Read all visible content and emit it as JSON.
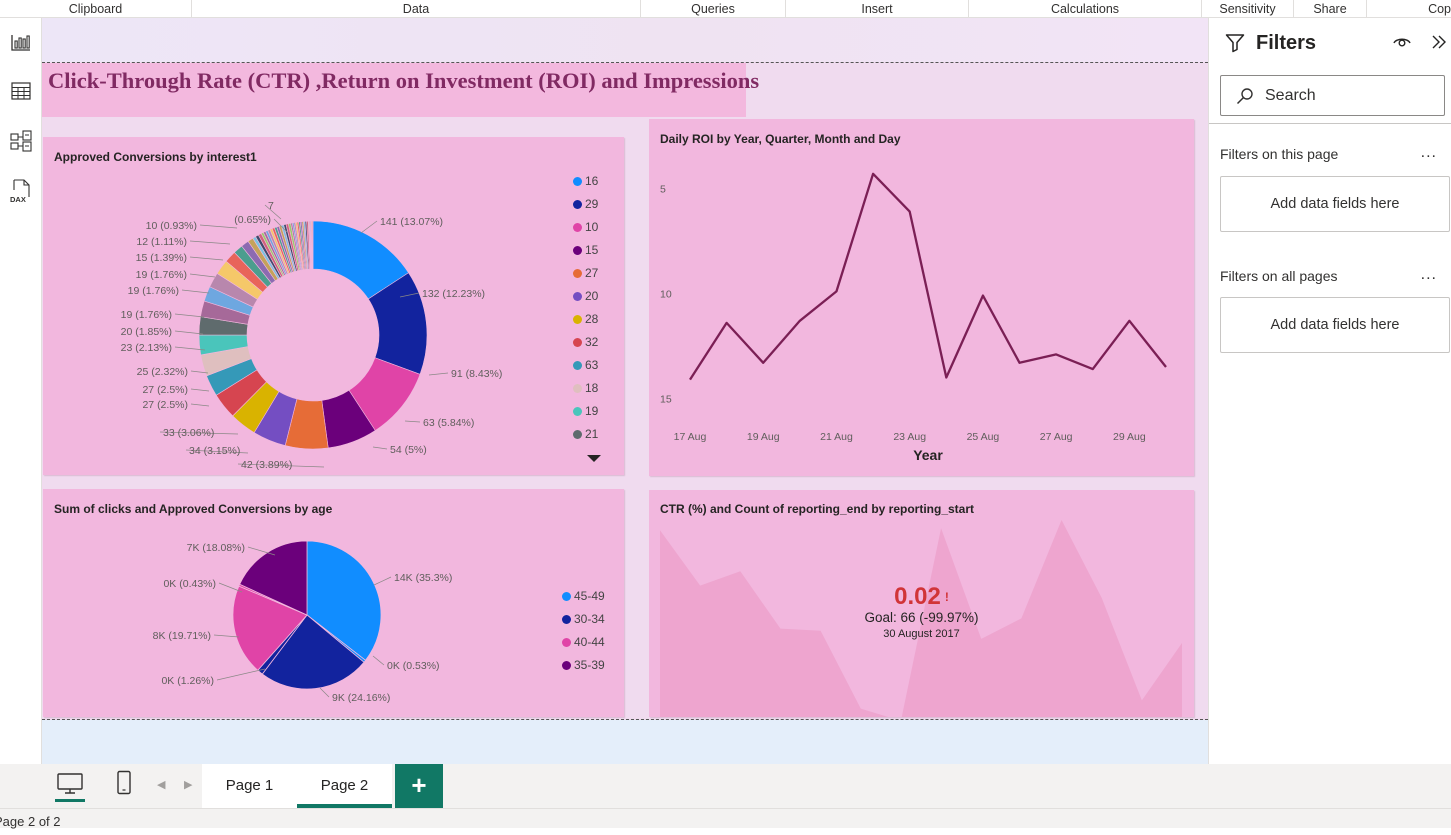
{
  "ribbon": {
    "groups": [
      "Clipboard",
      "Data",
      "Queries",
      "Insert",
      "Calculations",
      "Sensitivity",
      "Share",
      "Cop"
    ]
  },
  "left_nav": {
    "icons": [
      "report-view-icon",
      "table-view-icon",
      "model-view-icon",
      "dax-query-view-icon"
    ],
    "dax_label": "DAX"
  },
  "report": {
    "title": "Click-Through Rate (CTR) ,Return on Investment (ROI) and Impressions",
    "colors": {
      "title": "#812a63",
      "visual_bg": "#f2b7de",
      "line": "#7b1f55",
      "kpi": "#d13438"
    }
  },
  "donut": {
    "title": "Approved Conversions by interest1",
    "legend": [
      {
        "label": "16",
        "color": "#118dff"
      },
      {
        "label": "29",
        "color": "#12239e"
      },
      {
        "label": "10",
        "color": "#e044a7"
      },
      {
        "label": "15",
        "color": "#6b007b"
      },
      {
        "label": "27",
        "color": "#e66c37"
      },
      {
        "label": "20",
        "color": "#744ec2"
      },
      {
        "label": "28",
        "color": "#d9b300"
      },
      {
        "label": "32",
        "color": "#d64550"
      },
      {
        "label": "63",
        "color": "#3599b8"
      },
      {
        "label": "18",
        "color": "#dfbfbf"
      },
      {
        "label": "19",
        "color": "#4ac5bb"
      },
      {
        "label": "21",
        "color": "#5f6b6d"
      }
    ],
    "data_labels": [
      "141 (13.07%)",
      "132 (12.23%)",
      "91 (8.43%)",
      "63 (5.84%)",
      "54 (5%)",
      "42 (3.89%)",
      "34 (3.15%)",
      "33 (3.06%)",
      "27 (2.5%)",
      "27 (2.5%)",
      "25 (2.32%)",
      "23 (2.13%)",
      "20 (1.85%)",
      "19 (1.76%)",
      "19 (1.76%)",
      "19 (1.76%)",
      "15 (1.39%)",
      "12 (1.11%)",
      "10 (0.93%)",
      "7",
      "(0.65%)"
    ]
  },
  "pie": {
    "title": "Sum of clicks and Approved Conversions by age",
    "legend": [
      {
        "label": "45-49",
        "color": "#118dff"
      },
      {
        "label": "30-34",
        "color": "#12239e"
      },
      {
        "label": "40-44",
        "color": "#e044a7"
      },
      {
        "label": "35-39",
        "color": "#6b007b"
      }
    ],
    "data_labels": [
      "14K (35.3%)",
      "0K (0.53%)",
      "9K (24.16%)",
      "0K (1.26%)",
      "8K (19.71%)",
      "0K (0.43%)",
      "7K (18.08%)"
    ]
  },
  "line_visual": {
    "title": "Daily ROI by Year, Quarter, Month and Day",
    "xlabel": "Year",
    "y_ticks": [
      "15",
      "10",
      "5"
    ],
    "x_ticks": [
      "17 Aug",
      "19 Aug",
      "21 Aug",
      "23 Aug",
      "25 Aug",
      "27 Aug",
      "29 Aug"
    ]
  },
  "kpi_visual": {
    "title": "CTR (%) and Count of reporting_end by reporting_start",
    "value": "0.02",
    "indicator": "!",
    "goal": "Goal: 66 (-99.97%)",
    "date": "30 August 2017"
  },
  "filters_pane": {
    "title": "Filters",
    "search_placeholder": "Search",
    "section_page": "Filters on this page",
    "section_all": "Filters on all pages",
    "add_fields": "Add data fields here",
    "more": "..."
  },
  "page_tabs": {
    "tabs": [
      "Page 1",
      "Page 2"
    ],
    "active": "Page 2",
    "add_label": "+"
  },
  "status_bar": {
    "text": "Page 2 of 2"
  },
  "chart_data": [
    {
      "type": "pie",
      "title": "Approved Conversions by interest1",
      "categories": [
        "16",
        "29",
        "10",
        "15",
        "27",
        "20",
        "28",
        "32",
        "63",
        "18",
        "19",
        "21"
      ],
      "slice_values": [
        141,
        132,
        91,
        63,
        54,
        42,
        34,
        33,
        27,
        27,
        25,
        23,
        20,
        19,
        19,
        19,
        15,
        12,
        10,
        7,
        4,
        4,
        4,
        3,
        3,
        3,
        3,
        3,
        3,
        3,
        3,
        3,
        3,
        3,
        3,
        3,
        2,
        2,
        2,
        2,
        2,
        2,
        2,
        2,
        2,
        2,
        2,
        1,
        1,
        1,
        1,
        1,
        1
      ],
      "slice_labels": [
        "141 (13.07%)",
        "132 (12.23%)",
        "91 (8.43%)",
        "63 (5.84%)",
        "54 (5%)",
        "42 (3.89%)",
        "34 (3.15%)",
        "33 (3.06%)",
        "27 (2.5%)",
        "27 (2.5%)",
        "25 (2.32%)",
        "23 (2.13%)",
        "20 (1.85%)",
        "19 (1.76%)",
        "19 (1.76%)",
        "19 (1.76%)",
        "15 (1.39%)",
        "12 (1.11%)",
        "10 (0.93%)",
        "7 (0.65%)"
      ],
      "donut": true
    },
    {
      "type": "pie",
      "title": "Sum of clicks and Approved Conversions by age",
      "slices": [
        {
          "label": "14K (35.3%)",
          "value": 35.3,
          "color": "#118dff"
        },
        {
          "label": "0K (0.53%)",
          "value": 0.53,
          "color": "#118dff"
        },
        {
          "label": "9K (24.16%)",
          "value": 24.16,
          "color": "#12239e"
        },
        {
          "label": "0K (1.26%)",
          "value": 1.26,
          "color": "#12239e"
        },
        {
          "label": "8K (19.71%)",
          "value": 19.71,
          "color": "#e044a7"
        },
        {
          "label": "0K (0.43%)",
          "value": 0.43,
          "color": "#e044a7"
        },
        {
          "label": "7K (18.08%)",
          "value": 18.08,
          "color": "#6b007b"
        }
      ],
      "legend": [
        "45-49",
        "30-34",
        "40-44",
        "35-39"
      ]
    },
    {
      "type": "line",
      "title": "Daily ROI by Year, Quarter, Month and Day",
      "xlabel": "Year",
      "x": [
        "17 Aug",
        "18 Aug",
        "19 Aug",
        "20 Aug",
        "21 Aug",
        "22 Aug",
        "23 Aug",
        "24 Aug",
        "25 Aug",
        "26 Aug",
        "27 Aug",
        "28 Aug",
        "29 Aug",
        "30 Aug"
      ],
      "y": [
        5.9,
        8.6,
        6.7,
        8.7,
        10.1,
        15.7,
        13.9,
        6.0,
        9.9,
        6.7,
        7.1,
        6.4,
        8.7,
        6.5
      ],
      "ylim": [
        4.5,
        16.5
      ],
      "x_ticks": [
        "17 Aug",
        "19 Aug",
        "21 Aug",
        "23 Aug",
        "25 Aug",
        "27 Aug",
        "29 Aug"
      ],
      "y_ticks": [
        5,
        10,
        15
      ]
    },
    {
      "type": "area",
      "title": "CTR (%) and Count of reporting_end by reporting_start",
      "values": [
        0.95,
        0.68,
        0.75,
        0.47,
        0.46,
        0.08,
        0.02,
        0.96,
        0.42,
        0.52,
        1.0,
        0.62,
        0.12,
        0.4
      ],
      "kpi_value": "0.02",
      "goal": "Goal: 66 (-99.97%)",
      "date": "30 August 2017"
    }
  ]
}
